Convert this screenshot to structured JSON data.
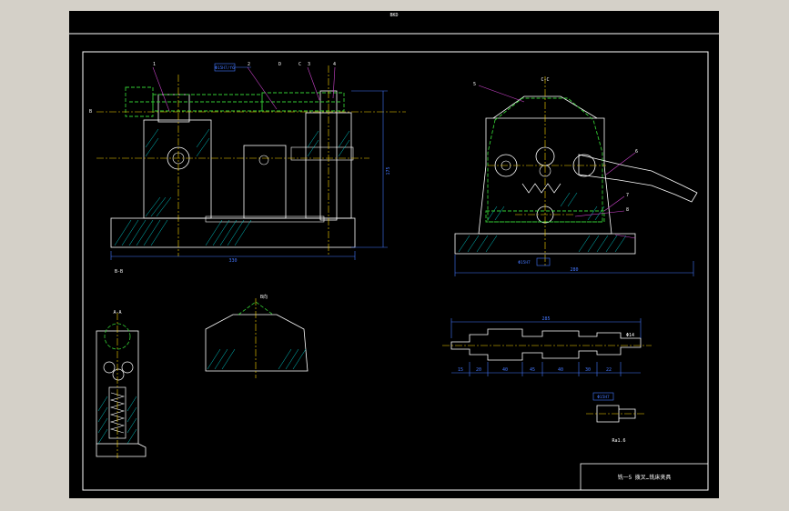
{
  "window": {
    "title": "BKD"
  },
  "title_block": {
    "text": "铣一5 拨叉…铣床夹具"
  },
  "main_view": {
    "dimensions": {
      "total_length": "330",
      "height": "175",
      "fit": "Φ15H7/f6"
    },
    "section_labels": {
      "b": "B",
      "d": "D",
      "c": "C",
      "section_bottom": "B-B"
    },
    "leaders": [
      "1",
      "2",
      "3",
      "4"
    ]
  },
  "side_view": {
    "section_label": "C-C",
    "dimensions": {
      "width": "280",
      "fit": "Φ15H7"
    },
    "leaders": [
      "5",
      "6",
      "7",
      "8"
    ]
  },
  "section_view": {
    "label": "A-A"
  },
  "detail_view": {
    "label": "B向"
  },
  "shaft_view": {
    "dimensions": {
      "total": "285",
      "segments": [
        "15",
        "20",
        "40",
        "45",
        "40",
        "30",
        "22"
      ],
      "end_label": "Φ14"
    }
  },
  "small_part": {
    "label": "Φ15H7",
    "caption": "Ra1.6"
  },
  "colors": {
    "background": "#000000",
    "frame": "#ffffff",
    "part": "#ffffff",
    "centerline": "#ffd700",
    "hidden": "#33cc33",
    "hatch": "#00cccc",
    "dimension": "#4477ff",
    "leader": "#cc44cc"
  }
}
